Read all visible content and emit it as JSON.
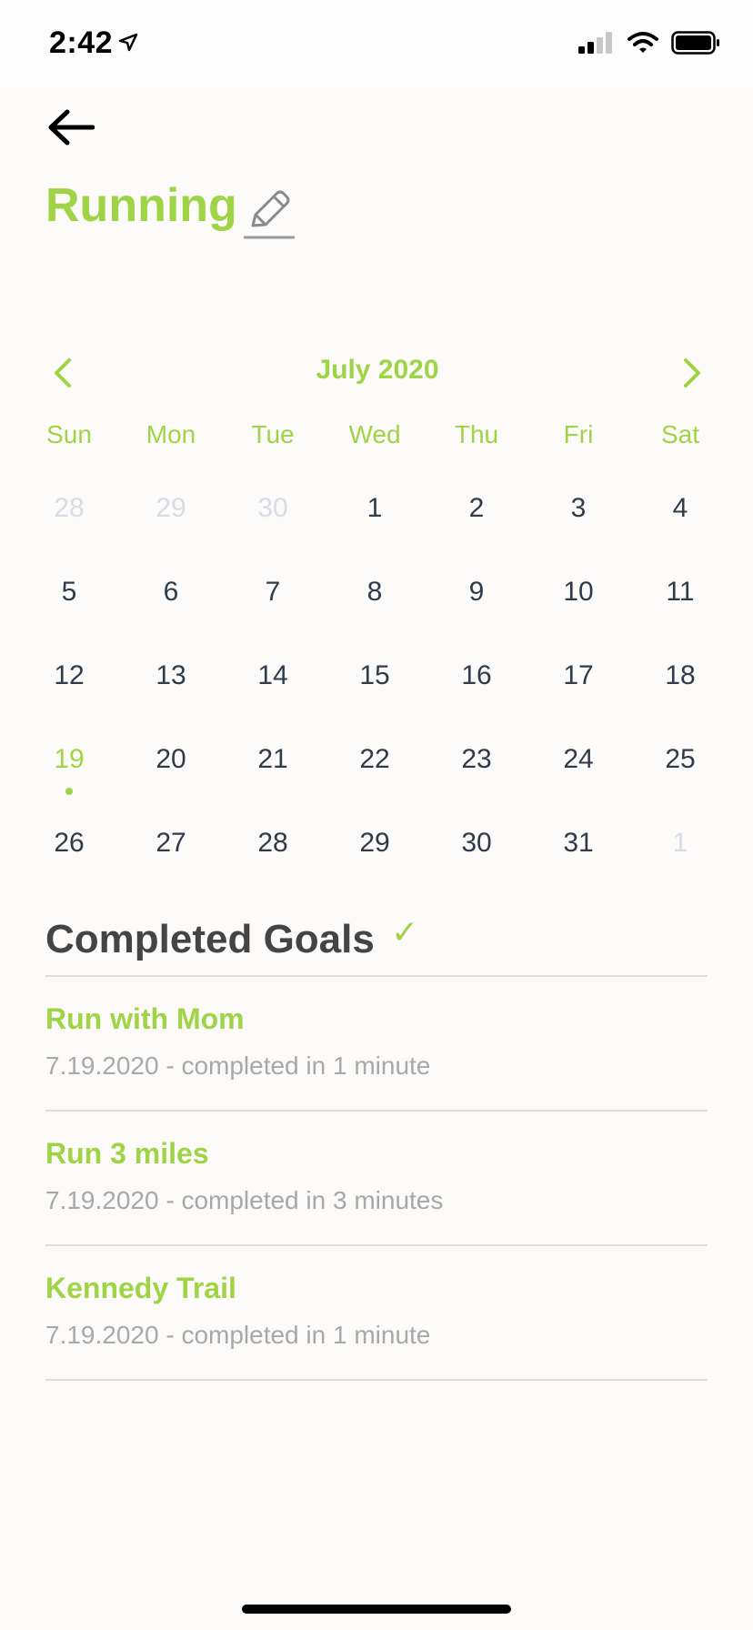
{
  "status": {
    "time": "2:42"
  },
  "header": {
    "title": "Running"
  },
  "calendar": {
    "month": "July 2020",
    "weekdays": [
      "Sun",
      "Mon",
      "Tue",
      "Wed",
      "Thu",
      "Fri",
      "Sat"
    ],
    "days": [
      {
        "d": "28",
        "muted": true
      },
      {
        "d": "29",
        "muted": true
      },
      {
        "d": "30",
        "muted": true
      },
      {
        "d": "1"
      },
      {
        "d": "2"
      },
      {
        "d": "3"
      },
      {
        "d": "4"
      },
      {
        "d": "5"
      },
      {
        "d": "6"
      },
      {
        "d": "7"
      },
      {
        "d": "8"
      },
      {
        "d": "9"
      },
      {
        "d": "10"
      },
      {
        "d": "11"
      },
      {
        "d": "12"
      },
      {
        "d": "13"
      },
      {
        "d": "14"
      },
      {
        "d": "15"
      },
      {
        "d": "16"
      },
      {
        "d": "17"
      },
      {
        "d": "18"
      },
      {
        "d": "19",
        "today": true
      },
      {
        "d": "20"
      },
      {
        "d": "21"
      },
      {
        "d": "22"
      },
      {
        "d": "23"
      },
      {
        "d": "24"
      },
      {
        "d": "25"
      },
      {
        "d": "26"
      },
      {
        "d": "27"
      },
      {
        "d": "28"
      },
      {
        "d": "29"
      },
      {
        "d": "30"
      },
      {
        "d": "31"
      },
      {
        "d": "1",
        "muted": true
      }
    ]
  },
  "goals": {
    "title": "Completed Goals",
    "check": "✓",
    "items": [
      {
        "title": "Run with Mom",
        "subtitle": "7.19.2020 - completed in 1 minute"
      },
      {
        "title": "Run 3 miles",
        "subtitle": "7.19.2020 - completed in 3 minutes"
      },
      {
        "title": "Kennedy Trail",
        "subtitle": "7.19.2020 - completed in 1 minute"
      }
    ]
  },
  "colors": {
    "accent": "#9fd447",
    "text": "#2f3b4a",
    "muted": "#d6dde6",
    "subtle": "#a8a8a8",
    "background": "#fcfbf9"
  }
}
